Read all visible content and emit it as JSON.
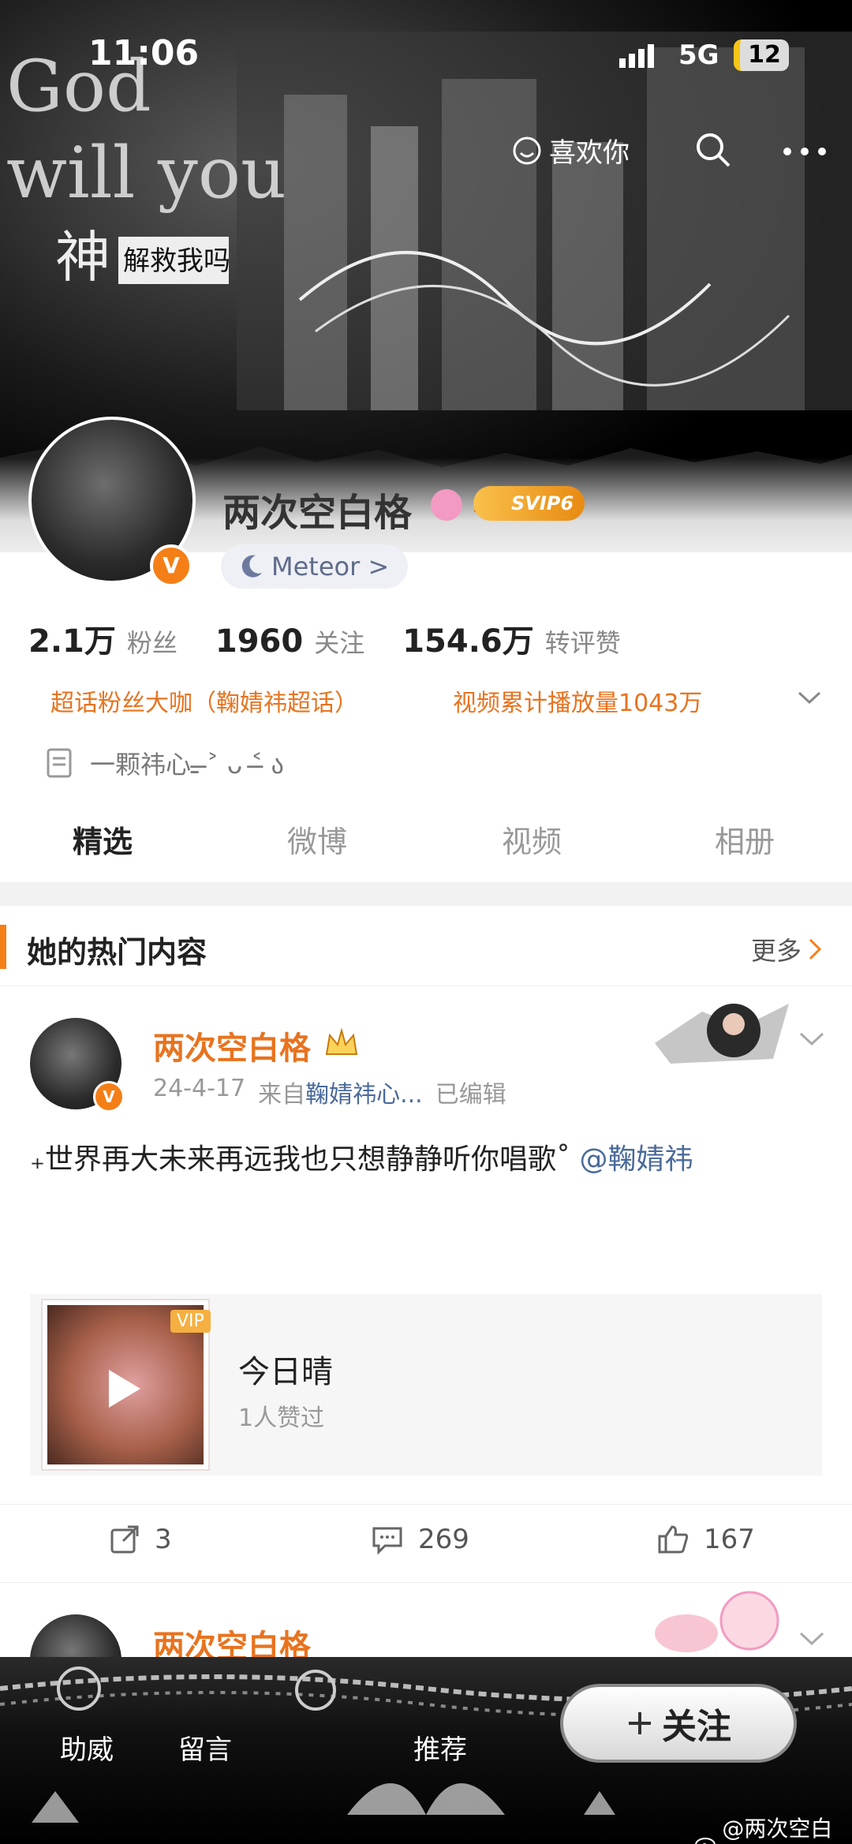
{
  "status_bar": {
    "time": "11:06",
    "network": "5G",
    "battery": "12"
  },
  "header": {
    "like_label": "喜欢你",
    "banner_texts": [
      "God",
      "will you",
      "神",
      "解救我吗"
    ]
  },
  "profile": {
    "name": "两次空白格",
    "svip": "SVIP6",
    "verified_badge": "V",
    "meteor_label": "Meteor >",
    "stats": [
      {
        "value": "2.1万",
        "label": "粉丝"
      },
      {
        "value": "1960",
        "label": "关注"
      },
      {
        "value": "154.6万",
        "label": "转评赞"
      }
    ],
    "tags": [
      "超话粉丝大咖（鞠婧祎超话）",
      "视频累计播放量1043万"
    ],
    "bio": "一颗祎心ـ ˃̶ ᴗ ˂̶ ა"
  },
  "tabs": [
    "精选",
    "微博",
    "视频",
    "相册"
  ],
  "hot_section": {
    "title": "她的热门内容",
    "more": "更多"
  },
  "post": {
    "author": "两次空白格",
    "date": "24-4-17",
    "source_prefix": "来自",
    "source": "鞠婧祎心...",
    "edited": "已编辑",
    "text": "₊世界再大未来再远我也只想静静听你唱歌˚ ",
    "mention": "@鞠婧祎",
    "music": {
      "title": "今日晴",
      "subtitle": "1人赞过",
      "vip": "VIP"
    },
    "actions": {
      "repost": "3",
      "comment": "269",
      "like": "167"
    }
  },
  "post2": {
    "author": "两次空白格"
  },
  "bottom_bar": {
    "items": [
      "助威",
      "留言",
      "推荐"
    ],
    "follow": "关注",
    "watermark": "@两次空白格"
  },
  "colors": {
    "accent": "#e8731f",
    "link": "#4a6a9a",
    "badge": "#f57f17"
  },
  "icons": [
    "signal-icon",
    "smile-icon",
    "search-icon",
    "more-icon",
    "gender-female-icon",
    "crown-icon",
    "moon-icon",
    "chevron-down-icon",
    "document-icon",
    "repost-icon",
    "comment-icon",
    "like-icon",
    "play-icon",
    "plus-icon",
    "weibo-logo-icon"
  ]
}
